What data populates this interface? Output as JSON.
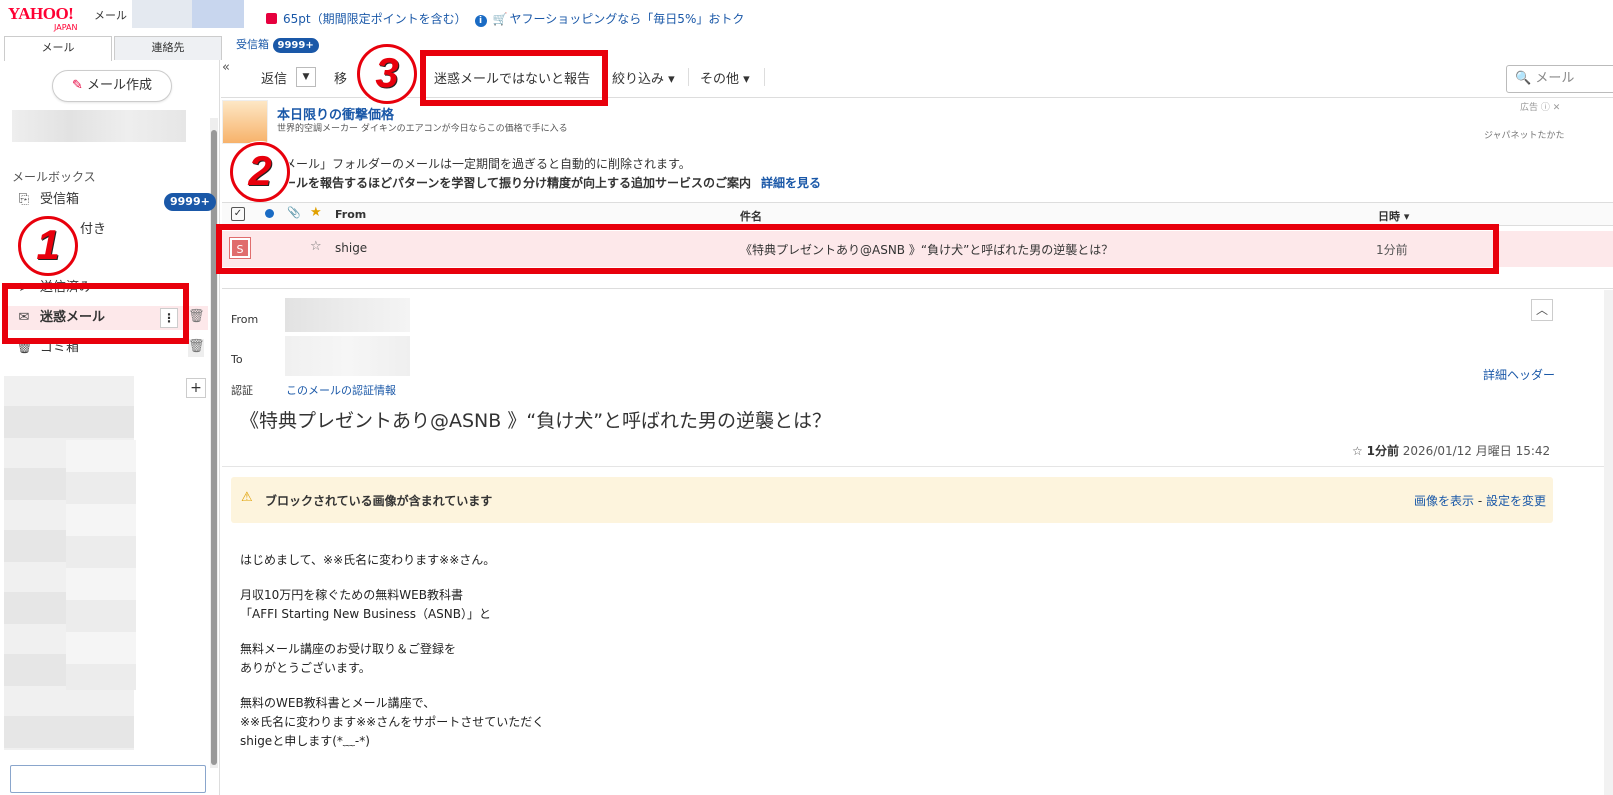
{
  "header": {
    "logo_main": "YAHOO!",
    "logo_sub": "JAPAN",
    "logo_service": "メール",
    "points_text": "65pt（期間限定ポイントを含む）",
    "shopping_text": "ヤフーショッピングなら「毎日5%」おトク"
  },
  "tabs": {
    "mail": "メール",
    "contacts": "連絡先",
    "inbox": "受信箱",
    "inbox_count": "9999+"
  },
  "sidebar": {
    "compose": "メール作成",
    "mailbox_label": "メールボックス",
    "items": [
      {
        "label": "受信箱",
        "icon": "inbox-icon",
        "badge": "9999+"
      },
      {
        "label": "付き",
        "icon": "star-icon"
      },
      {
        "label": "送信済み",
        "icon": "send-icon"
      },
      {
        "label": "迷惑メール",
        "icon": "spam-icon"
      },
      {
        "label": "ゴミ箱",
        "icon": "trash-icon"
      }
    ],
    "add_folder": "+"
  },
  "annotations": {
    "one": "1",
    "two": "2",
    "three": "3"
  },
  "toolbar": {
    "reply": "返信",
    "move": "移",
    "not_spam": "迷惑メールではないと報告",
    "filter": "絞り込み ▾",
    "other": "その他 ▾",
    "search_placeholder": "メール",
    "collapse": "«"
  },
  "ad": {
    "title": "本日限りの衝撃価格",
    "desc": "世界的空調メーカー ダイキンのエアコンが今日ならこの価格で手に入る",
    "label": "広告",
    "sponsor": "ジャパネットたかた"
  },
  "notice": {
    "line1": "メール」フォルダーのメールは一定期間を過ぎると自動的に削除されます。",
    "line2": "ールを報告するほどパターンを学習して振り分け精度が向上する追加サービスのご案内",
    "link": "詳細を見る"
  },
  "list": {
    "columns": {
      "from": "From",
      "subject": "件名",
      "date": "日時 ▾"
    },
    "rows": [
      {
        "avatar": "S",
        "from": "shige",
        "subject": "《特典プレゼントあり@ASNB 》“負け犬”と呼ばれた男の逆襲とは？",
        "date": "1分前"
      }
    ]
  },
  "detail": {
    "from_label": "From",
    "to_label": "To",
    "auth_label": "認証",
    "auth_link": "このメールの認証情報",
    "header_link": "詳細ヘッダー",
    "subject": "《特典プレゼントあり@ASNB 》“負け犬”と呼ばれた男の逆襲とは？",
    "relative_time": "1分前",
    "datetime": "2026/01/12 月曜日 15:42",
    "blocked_msg": "ブロックされている画像が含まれています",
    "show_images": "画像を表示",
    "separator": " - ",
    "change_settings": "設定を変更",
    "body": [
      "はじめまして、※※氏名に変わります※※さん。",
      "月収10万円を稼ぐための無料WEB教科書\n「AFFI Starting New Business（ASNB）」と",
      "無料メール講座のお受け取り＆ご登録を\nありがとうございます。",
      "無料のWEB教科書とメール講座で、\n※※氏名に変わります※※さんをサポートさせていただく\nshigeと申します(*﹏-*)"
    ]
  },
  "colors": {
    "brand": "#ff0033",
    "link": "#1a58a8",
    "highlight": "#e8000c",
    "selected_row": "#fde8ea"
  }
}
